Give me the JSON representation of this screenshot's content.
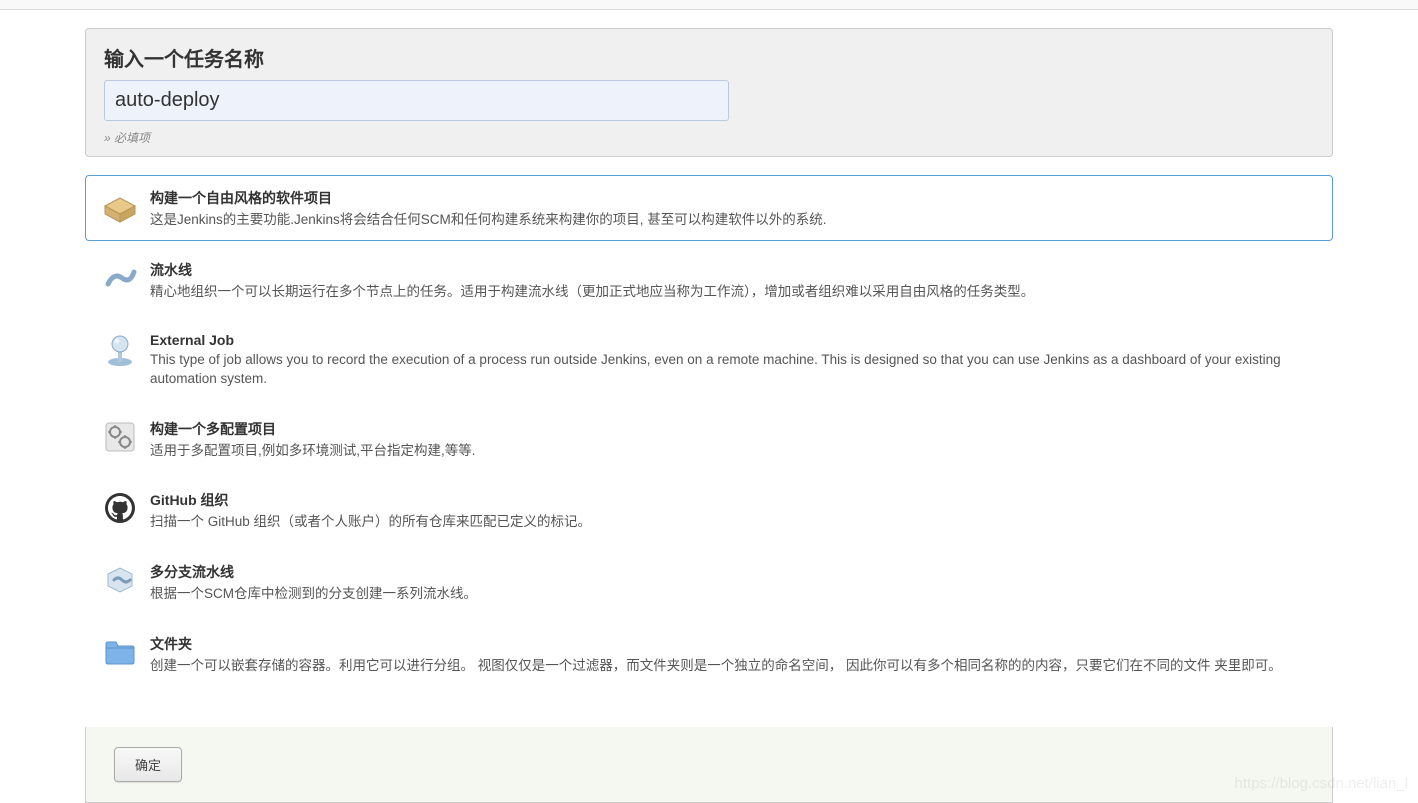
{
  "header": {
    "title": "输入一个任务名称",
    "input_value": "auto-deploy",
    "required_hint": "» 必填项"
  },
  "types": [
    {
      "id": "freestyle",
      "title": "构建一个自由风格的软件项目",
      "desc": "这是Jenkins的主要功能.Jenkins将会结合任何SCM和任何构建系统来构建你的项目, 甚至可以构建软件以外的系统.",
      "selected": true
    },
    {
      "id": "pipeline",
      "title": "流水线",
      "desc": "精心地组织一个可以长期运行在多个节点上的任务。适用于构建流水线（更加正式地应当称为工作流），增加或者组织难以采用自由风格的任务类型。",
      "selected": false
    },
    {
      "id": "external",
      "title": "External Job",
      "desc": "This type of job allows you to record the execution of a process run outside Jenkins, even on a remote machine. This is designed so that you can use Jenkins as a dashboard of your existing automation system.",
      "selected": false
    },
    {
      "id": "multiconfig",
      "title": "构建一个多配置项目",
      "desc": "适用于多配置项目,例如多环境测试,平台指定构建,等等.",
      "selected": false
    },
    {
      "id": "github-org",
      "title": "GitHub 组织",
      "desc": "扫描一个 GitHub 组织（或者个人账户）的所有仓库来匹配已定义的标记。",
      "selected": false
    },
    {
      "id": "multibranch",
      "title": "多分支流水线",
      "desc": "根据一个SCM仓库中检测到的分支创建一系列流水线。",
      "selected": false
    },
    {
      "id": "folder",
      "title": "文件夹",
      "desc": "创建一个可以嵌套存储的容器。利用它可以进行分组。 视图仅仅是一个过滤器，而文件夹则是一个独立的命名空间， 因此你可以有多个相同名称的的内容，只要它们在不同的文件 夹里即可。",
      "selected": false
    }
  ],
  "footer": {
    "ok_label": "确定"
  },
  "watermark": "https://blog.csdn.net/lian_l"
}
